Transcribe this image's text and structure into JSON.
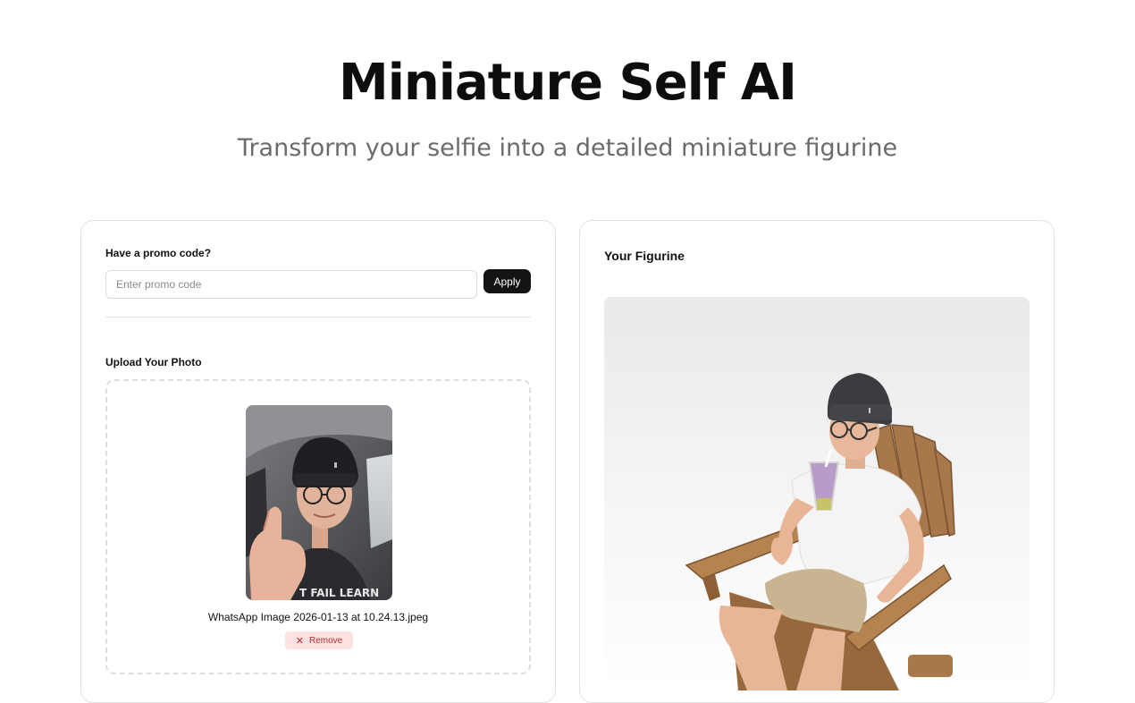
{
  "header": {
    "title": "Miniature Self AI",
    "subtitle": "Transform your selfie into a detailed miniature figurine"
  },
  "promo": {
    "label": "Have a promo code?",
    "placeholder": "Enter promo code",
    "value": "",
    "apply_label": "Apply"
  },
  "upload": {
    "label": "Upload Your Photo",
    "file_name": "WhatsApp Image 2026-01-13 at 10.24.13.jpeg",
    "remove_label": "Remove",
    "remove_icon": "close-icon",
    "shirt_text": "T FAIL LEARN"
  },
  "result": {
    "title": "Your Figurine"
  },
  "colors": {
    "accent": "#141414",
    "remove_bg": "#fde2e2",
    "remove_text": "#c0262d",
    "subtitle": "#6b6b6b"
  }
}
